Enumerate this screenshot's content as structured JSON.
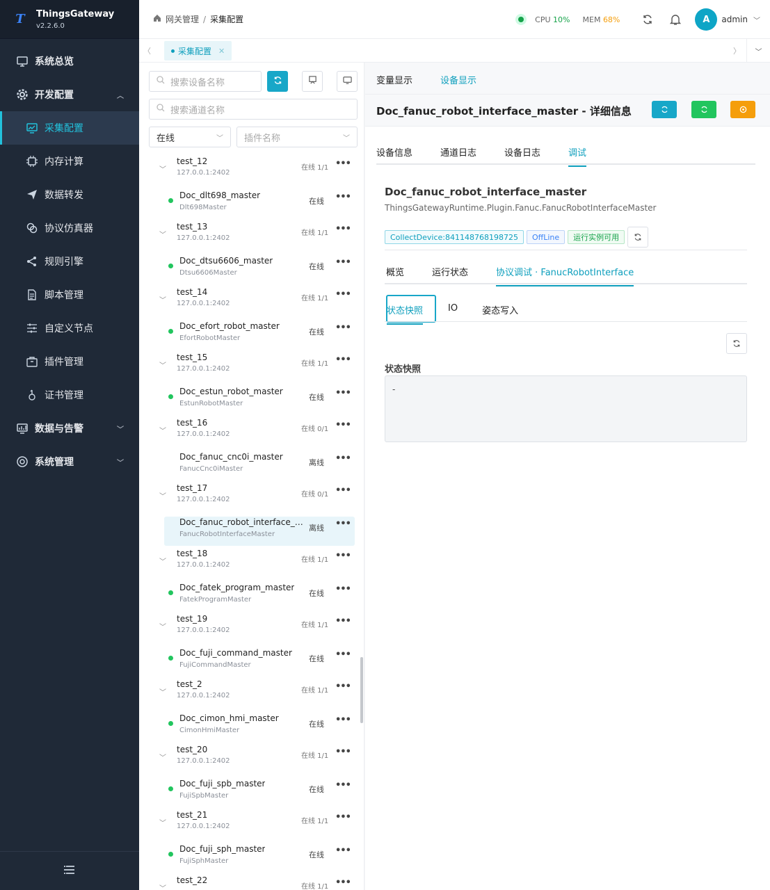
{
  "brand": {
    "name": "ThingsGateway",
    "version": "v2.2.6.0",
    "logo_letter": "T"
  },
  "sidebar": {
    "items": [
      {
        "label": "系统总览",
        "icon": "monitor-icon"
      },
      {
        "label": "开发配置",
        "icon": "gear-icon"
      },
      {
        "label": "采集配置",
        "icon": "chart-icon"
      },
      {
        "label": "内存计算",
        "icon": "chip-icon"
      },
      {
        "label": "数据转发",
        "icon": "send-icon"
      },
      {
        "label": "协议仿真器",
        "icon": "link-icon"
      },
      {
        "label": "规则引擎",
        "icon": "share-icon"
      },
      {
        "label": "脚本管理",
        "icon": "file-icon"
      },
      {
        "label": "自定义节点",
        "icon": "sliders-icon"
      },
      {
        "label": "插件管理",
        "icon": "package-icon"
      },
      {
        "label": "证书管理",
        "icon": "certificate-icon"
      },
      {
        "label": "数据与告警",
        "icon": "alarm-chart-icon"
      },
      {
        "label": "系统管理",
        "icon": "settings-icon"
      }
    ]
  },
  "header": {
    "breadcrumb": [
      "网关管理",
      "采集配置"
    ],
    "cpu_label": "CPU",
    "cpu_value": "10%",
    "mem_label": "MEM",
    "mem_value": "68%",
    "avatar_letter": "A",
    "username": "admin"
  },
  "tabstrip": {
    "active_tab": "采集配置"
  },
  "tree_panel": {
    "device_search_placeholder": "搜索设备名称",
    "channel_search_placeholder": "搜索通道名称",
    "status_filter": "在线",
    "plugin_filter_placeholder": "插件名称",
    "channels": [
      {
        "name": "test_12",
        "ip": "127.0.0.1:2402",
        "count": "在线 1/1",
        "device": "Doc_dlt698_master",
        "plugin": "Dlt698Master",
        "status": "在线",
        "online": true
      },
      {
        "name": "test_13",
        "ip": "127.0.0.1:2402",
        "count": "在线 1/1",
        "device": "Doc_dtsu6606_master",
        "plugin": "Dtsu6606Master",
        "status": "在线",
        "online": true
      },
      {
        "name": "test_14",
        "ip": "127.0.0.1:2402",
        "count": "在线 1/1",
        "device": "Doc_efort_robot_master",
        "plugin": "EfortRobotMaster",
        "status": "在线",
        "online": true
      },
      {
        "name": "test_15",
        "ip": "127.0.0.1:2402",
        "count": "在线 1/1",
        "device": "Doc_estun_robot_master",
        "plugin": "EstunRobotMaster",
        "status": "在线",
        "online": true
      },
      {
        "name": "test_16",
        "ip": "127.0.0.1:2402",
        "count": "在线 0/1",
        "device": "Doc_fanuc_cnc0i_master",
        "plugin": "FanucCnc0iMaster",
        "status": "离线",
        "online": false
      },
      {
        "name": "test_17",
        "ip": "127.0.0.1:2402",
        "count": "在线 0/1",
        "device": "Doc_fanuc_robot_interface_m...",
        "plugin": "FanucRobotInterfaceMaster",
        "status": "离线",
        "online": false,
        "selected": true
      },
      {
        "name": "test_18",
        "ip": "127.0.0.1:2402",
        "count": "在线 1/1",
        "device": "Doc_fatek_program_master",
        "plugin": "FatekProgramMaster",
        "status": "在线",
        "online": true
      },
      {
        "name": "test_19",
        "ip": "127.0.0.1:2402",
        "count": "在线 1/1",
        "device": "Doc_fuji_command_master",
        "plugin": "FujiCommandMaster",
        "status": "在线",
        "online": true
      },
      {
        "name": "test_2",
        "ip": "127.0.0.1:2402",
        "count": "在线 1/1",
        "device": "Doc_cimon_hmi_master",
        "plugin": "CimonHmiMaster",
        "status": "在线",
        "online": true
      },
      {
        "name": "test_20",
        "ip": "127.0.0.1:2402",
        "count": "在线 1/1",
        "device": "Doc_fuji_spb_master",
        "plugin": "FujiSpbMaster",
        "status": "在线",
        "online": true
      },
      {
        "name": "test_21",
        "ip": "127.0.0.1:2402",
        "count": "在线 1/1",
        "device": "Doc_fuji_sph_master",
        "plugin": "FujiSphMaster",
        "status": "在线",
        "online": true
      },
      {
        "name": "test_22",
        "ip": "",
        "count": "在线 1/1",
        "device": "",
        "plugin": "",
        "status": "",
        "online": true
      }
    ]
  },
  "right": {
    "top_tabs": [
      "变量显示",
      "设备显示"
    ],
    "detail_title": "Doc_fanuc_robot_interface_master - 详细信息",
    "tabs": [
      "设备信息",
      "通道日志",
      "设备日志",
      "调试"
    ],
    "device_name": "Doc_fanuc_robot_interface_master",
    "device_plugin": "ThingsGatewayRuntime.Plugin.Fanuc.FanucRobotInterfaceMaster",
    "badges": [
      "CollectDevice:841148768198725",
      "OffLine",
      "运行实例可用"
    ],
    "sub_tabs": [
      "概览",
      "运行状态",
      "协议调试 · FanucRobotInterface"
    ],
    "mini_tabs": [
      "状态快照",
      "IO",
      "姿态写入"
    ],
    "snapshot_label": "状态快照",
    "snapshot_value": "-"
  },
  "colors": {
    "accent": "#18a7c8",
    "sidebar_bg": "#1f2937",
    "online": "#22c55e",
    "warning": "#f59e0b"
  }
}
